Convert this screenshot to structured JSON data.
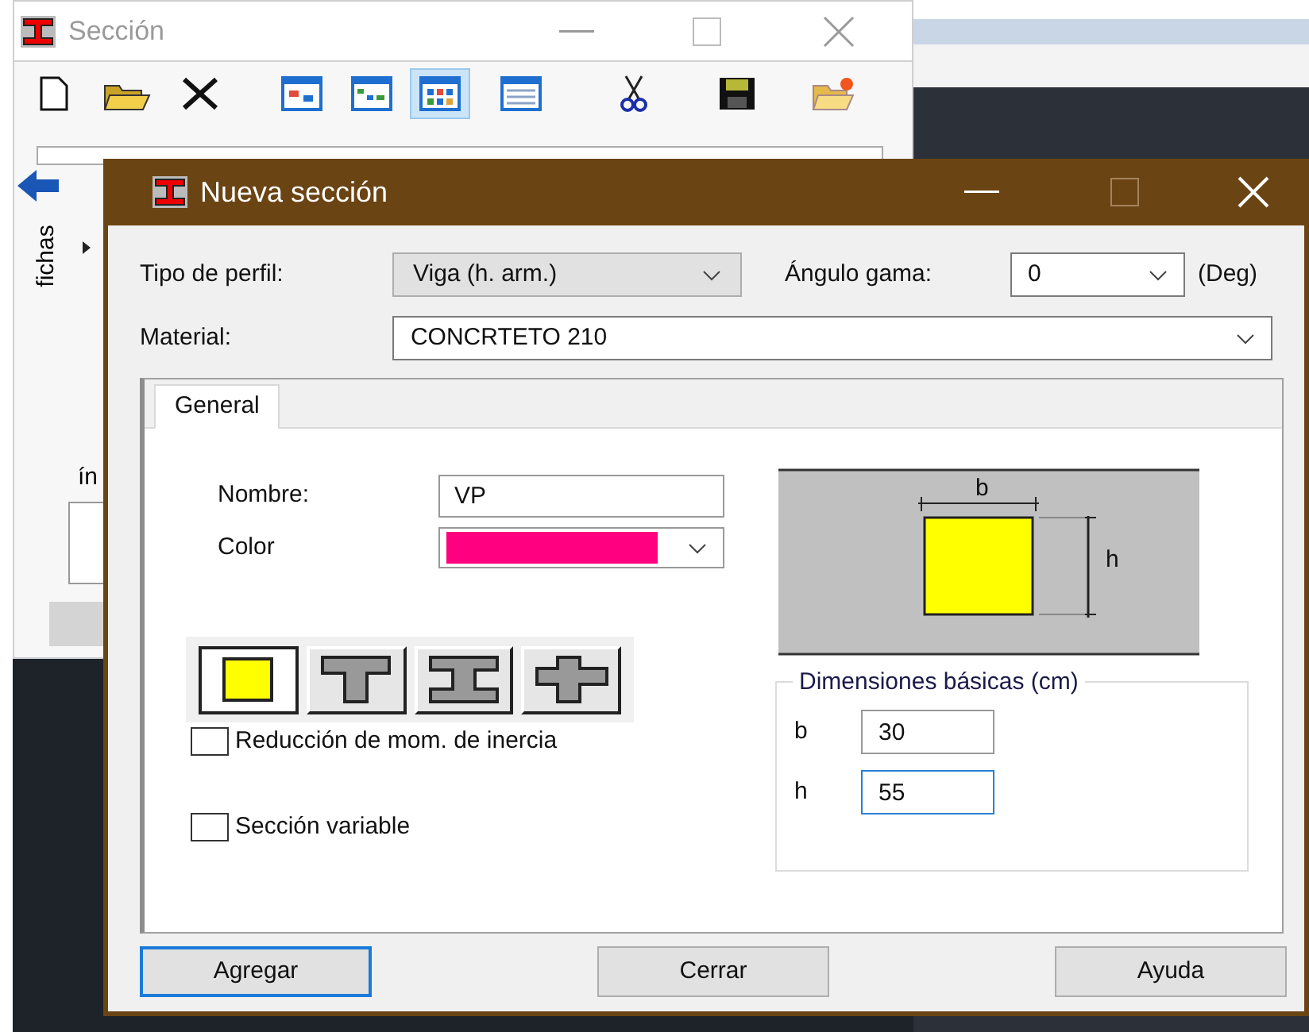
{
  "background_window": {
    "title": "Sección",
    "toolbar": [
      {
        "kind": "new",
        "selected": false
      },
      {
        "kind": "open",
        "selected": false
      },
      {
        "kind": "delete",
        "selected": false
      },
      {
        "kind": "view-a",
        "selected": false
      },
      {
        "kind": "view-b",
        "selected": false
      },
      {
        "kind": "view-c",
        "selected": true
      },
      {
        "kind": "view-d",
        "selected": false
      },
      {
        "kind": "cut",
        "selected": false
      },
      {
        "kind": "save",
        "selected": false
      },
      {
        "kind": "folder-new",
        "selected": false
      }
    ],
    "side_tab": "fichas",
    "partial_label": "ín"
  },
  "dialog": {
    "title": "Nueva sección",
    "profile_type": {
      "label": "Tipo de perfil:",
      "value": "Viga (h. arm.)"
    },
    "gamma_angle": {
      "label": "Ángulo gama:",
      "value": "0",
      "unit": "(Deg)"
    },
    "material": {
      "label": "Material:",
      "value": "CONCRTETO 210"
    },
    "tabs": [
      {
        "label": "General",
        "selected": true
      }
    ],
    "name": {
      "label": "Nombre:",
      "value": "VP"
    },
    "color": {
      "label": "Color",
      "color": "#ff0080"
    },
    "shapes": [
      {
        "kind": "rectangle",
        "selected": true
      },
      {
        "kind": "tee",
        "selected": false
      },
      {
        "kind": "i-beam",
        "selected": false
      },
      {
        "kind": "cross",
        "selected": false
      }
    ],
    "checkboxes": [
      {
        "label": "Reducción de mom. de inercia",
        "checked": false
      },
      {
        "label": "Sección variable",
        "checked": false
      }
    ],
    "diagram": {
      "width_label": "b",
      "height_label": "h"
    },
    "dimensions": {
      "title": "Dimensiones básicas (cm)",
      "fields": [
        {
          "label": "b",
          "value": "30",
          "focused": false
        },
        {
          "label": "h",
          "value": "55",
          "focused": true
        }
      ]
    },
    "buttons": [
      {
        "label": "Agregar",
        "default": true
      },
      {
        "label": "Cerrar",
        "default": false
      },
      {
        "label": "Ayuda",
        "default": false
      }
    ]
  }
}
